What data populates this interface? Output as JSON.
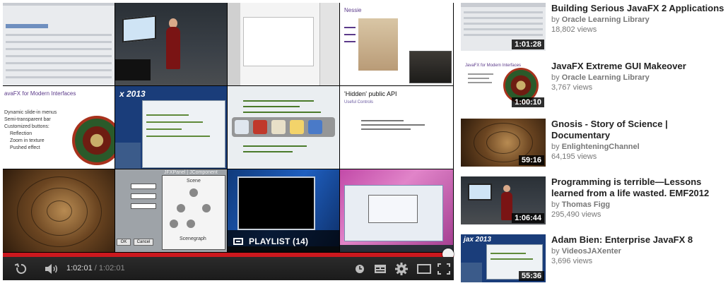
{
  "player": {
    "playlist_label": "PLAYLIST (14)",
    "current_time": "1:02:01",
    "separator": " / ",
    "duration": "1:02:01",
    "progress_fraction": 1.0,
    "accent_color": "#cc181e",
    "tiles": [
      {
        "id": "t1"
      },
      {
        "id": "t2"
      },
      {
        "id": "t3"
      },
      {
        "id": "t4",
        "text": "Nessie"
      },
      {
        "id": "t5",
        "lines": [
          "avaFX for Modern Interfaces",
          "Dynamic slide-in menus",
          "Semi-transparent bar",
          "Customized buttons:",
          "Reflection",
          "Zoom in texture",
          "Pushed effect"
        ]
      },
      {
        "id": "t6",
        "text": "x 2013"
      },
      {
        "id": "t7"
      },
      {
        "id": "t8",
        "lines": [
          "'Hidden' public API",
          "Useful Controls"
        ]
      },
      {
        "id": "t9"
      },
      {
        "id": "t10",
        "lines": [
          "JFXPanel",
          "JComponent",
          "Scene",
          "Scenegraph",
          "OK",
          "Cancel"
        ]
      },
      {
        "id": "t11"
      },
      {
        "id": "t12"
      }
    ],
    "controls": [
      "replay-icon",
      "volume-icon",
      "watch-later-icon",
      "captions-icon",
      "settings-icon",
      "theater-icon",
      "fullscreen-icon"
    ]
  },
  "related": [
    {
      "title": "Building Serious JavaFX 2 Applications",
      "by": "by",
      "channel": "Oracle Learning Library",
      "views": "18,802 views",
      "duration": "1:01:28"
    },
    {
      "title": "JavaFX Extreme GUI Makeover",
      "by": "by",
      "channel": "Oracle Learning Library",
      "views": "3,767 views",
      "duration": "1:00:10"
    },
    {
      "title": "Gnosis - Story of Science | Documentary",
      "by": "by",
      "channel": "EnlighteningChannel",
      "views": "64,195 views",
      "duration": "59:16"
    },
    {
      "title": "Programming is terrible—Lessons learned from a life wasted. EMF2012",
      "by": "by",
      "channel": "Thomas Figg",
      "views": "295,490 views",
      "duration": "1:06:44"
    },
    {
      "title": "Adam Bien: Enterprise JavaFX 8",
      "by": "by",
      "channel": "VideosJAXenter",
      "views": "3,696 views",
      "duration": "55:36"
    }
  ]
}
